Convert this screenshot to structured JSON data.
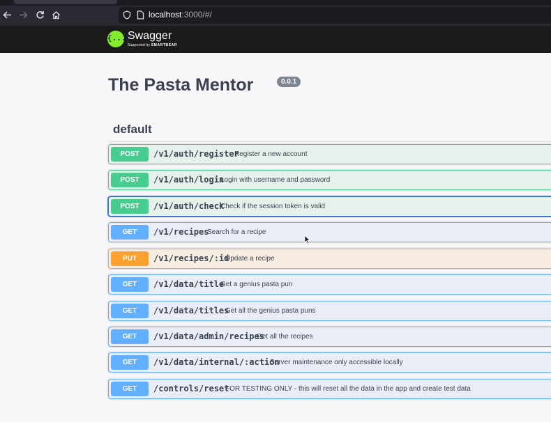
{
  "browser": {
    "url_host": "localhost",
    "url_rest": ":3000/#/"
  },
  "swagger": {
    "logo_text": "Swagger",
    "logo_mark": "{...}",
    "supported_by": "Supported by",
    "brand": "SMARTBEAR"
  },
  "api": {
    "title": "The Pasta Mentor",
    "version": "0.0.1"
  },
  "tag": {
    "name": "default"
  },
  "colors": {
    "post": "#49cc90",
    "get": "#61affe",
    "put": "#fca130",
    "focus": "#3b78d1",
    "topbar": "#1b1b1b"
  },
  "operations": [
    {
      "method": "POST",
      "path": "/v1/auth/register",
      "summary": "Register a new account"
    },
    {
      "method": "POST",
      "path": "/v1/auth/login",
      "summary": "Login with username and password"
    },
    {
      "method": "POST",
      "path": "/v1/auth/check",
      "summary": "Check if the session token is valid"
    },
    {
      "method": "GET",
      "path": "/v1/recipes",
      "summary": "Search for a recipe"
    },
    {
      "method": "PUT",
      "path": "/v1/recipes/:id",
      "summary": "Update a recipe"
    },
    {
      "method": "GET",
      "path": "/v1/data/title",
      "summary": "Get a genius pasta pun"
    },
    {
      "method": "GET",
      "path": "/v1/data/titles",
      "summary": "Get all the genius pasta puns"
    },
    {
      "method": "GET",
      "path": "/v1/data/admin/recipes",
      "summary": "Get all the recipes"
    },
    {
      "method": "GET",
      "path": "/v1/data/internal/:action",
      "summary": "Server maintenance only accessible locally"
    },
    {
      "method": "GET",
      "path": "/controls/reset",
      "summary": "FOR TESTING ONLY - this will reset all the data in the app and create test data"
    }
  ]
}
